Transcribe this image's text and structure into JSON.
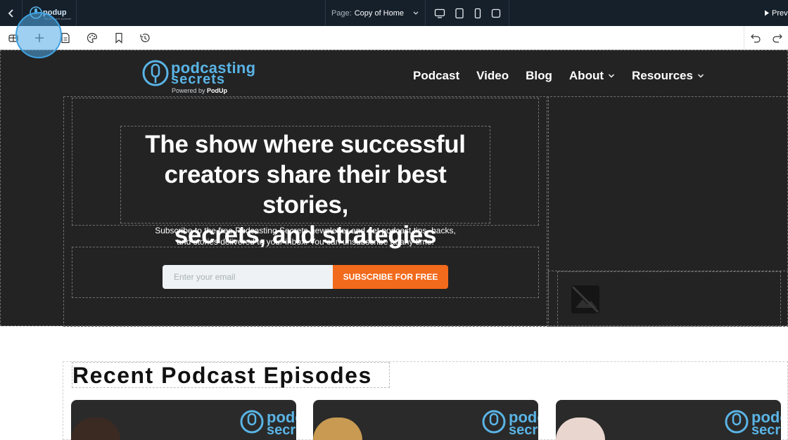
{
  "topbar": {
    "page_label": "Page:",
    "page_value": "Copy of Home",
    "preview_label": "Prev"
  },
  "site": {
    "logo_word1": "podcasting",
    "logo_word2": "secrets",
    "powered_by": "Powered by",
    "powered_brand": "PodUp"
  },
  "nav": {
    "podcast": "Podcast",
    "video": "Video",
    "blog": "Blog",
    "about": "About",
    "resources": "Resources"
  },
  "hero": {
    "headline_1": "The show where successful",
    "headline_2": "creators share their best stories,",
    "headline_3": "secrets, and strategies",
    "sub_1": "Subscribe to the free Podcasting Secrets newsletter and get podcast tips, hacks,",
    "sub_2": "and stories delivered to your inbox. You can unsubscribe at any time.",
    "email_placeholder": "Enter your email",
    "subscribe_label": "SUBSCRIBE FOR FREE"
  },
  "episodes": {
    "title": "Recent Podcast Episodes",
    "cards": [
      {
        "logo_1": "podc",
        "logo_2": "secre"
      },
      {
        "logo_1": "podc",
        "logo_2": "secr"
      },
      {
        "logo_1": "podc",
        "logo_2": "secr"
      }
    ]
  },
  "colors": {
    "topbar_bg": "#15202b",
    "hero_bg": "#232323",
    "accent_orange": "#f26a1b",
    "brand_blue": "#5ab4e6"
  },
  "icons": [
    "chevron-left-icon",
    "podup-logo",
    "chevron-down-icon",
    "desktop-icon",
    "tablet-icon",
    "mobile-icon",
    "square-icon",
    "play-icon",
    "widgets-icon",
    "plus-icon",
    "page-icon",
    "palette-icon",
    "bookmark-icon",
    "history-icon",
    "undo-icon",
    "redo-icon",
    "image-placeholder-icon"
  ]
}
